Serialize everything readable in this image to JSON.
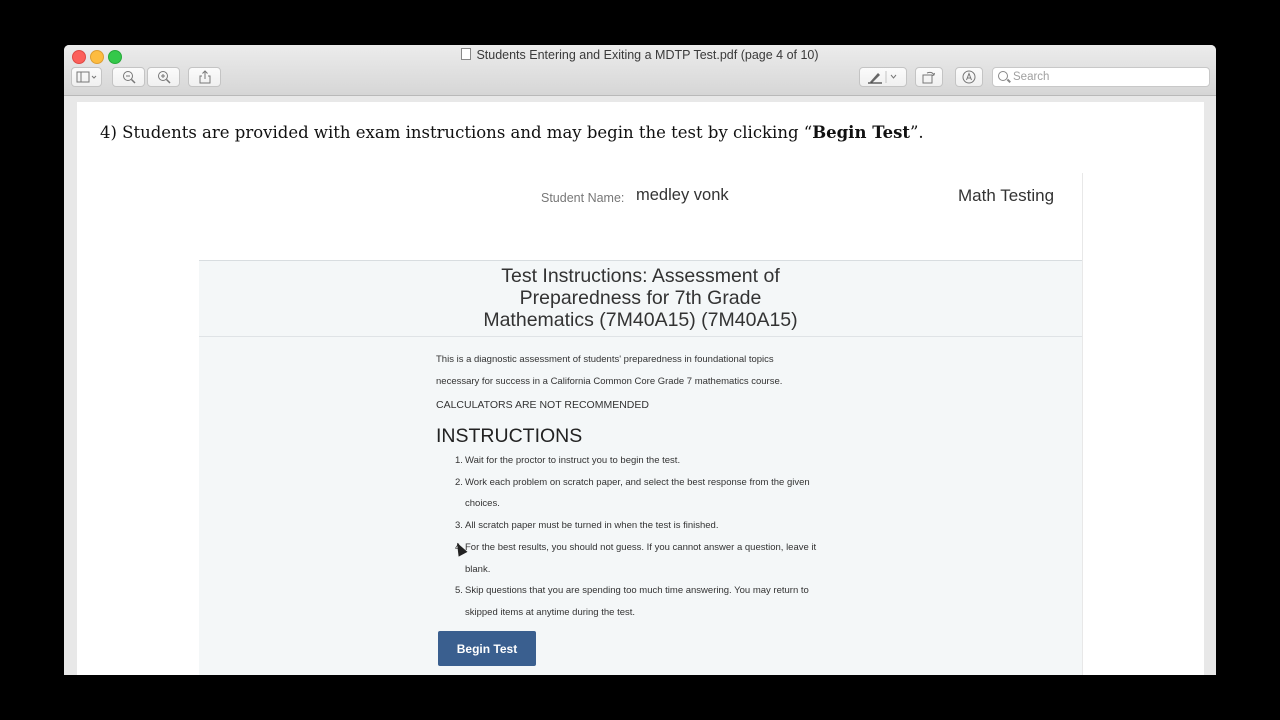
{
  "window": {
    "title": "Students Entering and Exiting a MDTP Test.pdf (page 4 of 10)"
  },
  "toolbar": {
    "sidebar_icon": "sidebar-icon",
    "zoom_out_icon": "zoom-out-icon",
    "zoom_in_icon": "zoom-in-icon",
    "share_icon": "share-icon",
    "markup_icon": "pen-icon",
    "rotate_icon": "rotate-icon",
    "annotate_icon": "markup-icon",
    "search_placeholder": "Search"
  },
  "document": {
    "heading_prefix": "4) Students are provided with exam instructions and may begin the test by clicking “",
    "heading_bold": "Begin Test",
    "heading_suffix": "”."
  },
  "app": {
    "student_name_label": "Student Name:",
    "student_name_value": "medley vonk",
    "header_right": "Math Testing",
    "instructions_title_line1": "Test Instructions: Assessment of",
    "instructions_title_line2": "Preparedness for 7th Grade",
    "instructions_title_line3": "Mathematics (7M40A15) (7M40A15)",
    "description_line1": "This is a diagnostic assessment of students' preparedness in foundational topics",
    "description_line2": "necessary for success in a California Common Core Grade 7 mathematics course.",
    "calculators_note": "CALCULATORS ARE NOT RECOMMENDED",
    "instructions_heading": "INSTRUCTIONS",
    "instructions": [
      {
        "num": "1.",
        "line1": "Wait for the proctor to instruct you to begin the test.",
        "line2": ""
      },
      {
        "num": "2.",
        "line1": "Work each problem on scratch paper, and select the best response from the given",
        "line2": "choices."
      },
      {
        "num": "3.",
        "line1": "All scratch paper must be turned in when the test is finished.",
        "line2": ""
      },
      {
        "num": "4.",
        "line1": "For the best results, you should not guess. If you cannot answer a question, leave it",
        "line2": "blank."
      },
      {
        "num": "5.",
        "line1": "Skip questions that you are spending too much time answering. You may return to",
        "line2": "skipped items at anytime during the test."
      }
    ],
    "begin_button": "Begin Test"
  }
}
